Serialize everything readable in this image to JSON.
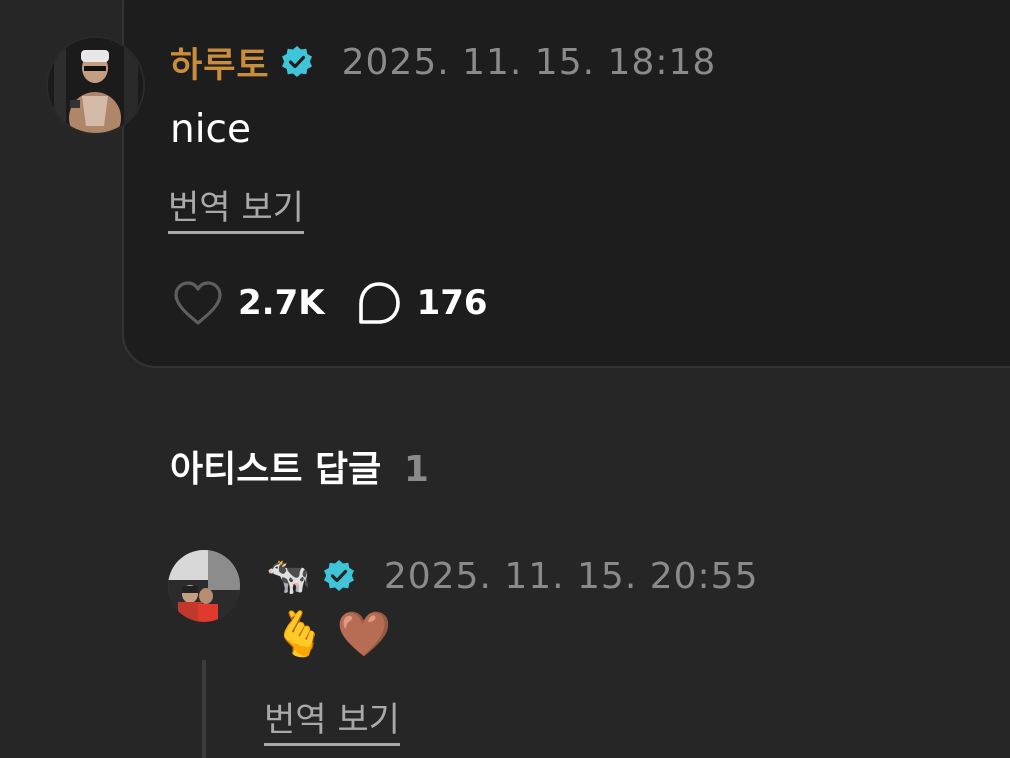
{
  "post": {
    "author": "하루토",
    "timestamp": "2025. 11. 15. 18:18",
    "text": "nice",
    "translate_label": "번역 보기",
    "likes": "2.7K",
    "comments": "176"
  },
  "artist_replies": {
    "title": "아티스트 답글",
    "count": "1"
  },
  "reply": {
    "author": "🐄",
    "timestamp": "2025. 11. 15. 20:55",
    "text": "🫰🤎",
    "translate_label": "번역 보기"
  },
  "colors": {
    "background": "#262626",
    "card": "#1d1d1d",
    "author_name": "#c98d3c",
    "verified_badge": "#3ec6d8",
    "muted_text": "#8a8a8a"
  },
  "icons": {
    "verified": "verified-badge-icon",
    "like": "heart-icon",
    "comment": "comment-bubble-icon"
  }
}
